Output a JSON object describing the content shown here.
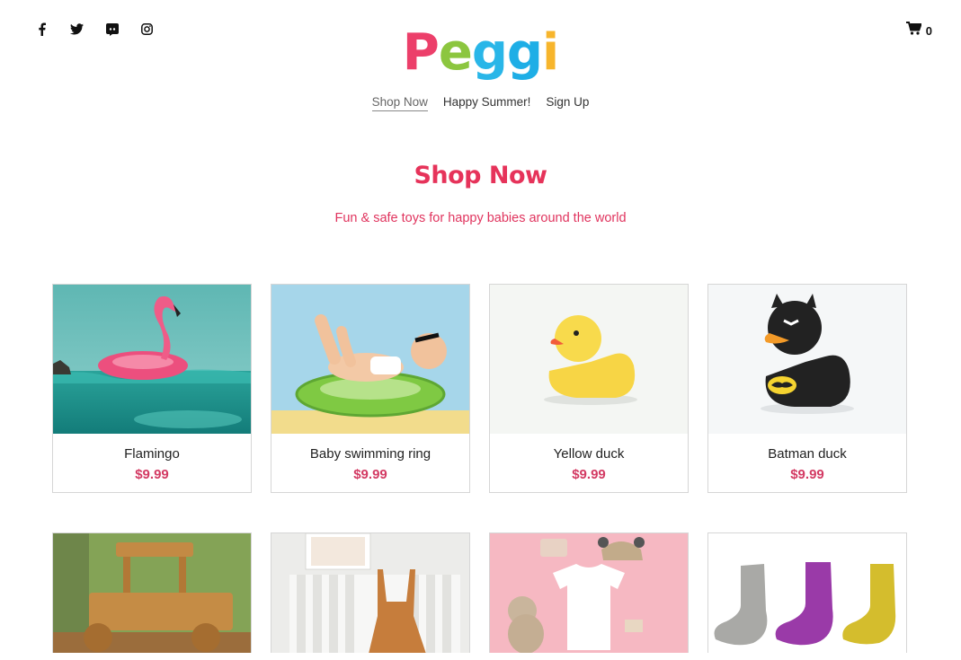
{
  "brand": {
    "letters": [
      {
        "char": "P",
        "color": "#ec3f6a"
      },
      {
        "char": "e",
        "color": "#8cc63f"
      },
      {
        "char": "g",
        "color": "#29b6e8"
      },
      {
        "char": "g",
        "color": "#1eaee6"
      },
      {
        "char": "i",
        "color": "#f7b52c"
      }
    ]
  },
  "social": [
    {
      "name": "facebook-icon"
    },
    {
      "name": "twitter-icon"
    },
    {
      "name": "discord-icon"
    },
    {
      "name": "instagram-icon"
    }
  ],
  "cart": {
    "icon": "cart-icon",
    "count": "0"
  },
  "nav": [
    {
      "label": "Shop Now",
      "active": true
    },
    {
      "label": "Happy Summer!",
      "active": false
    },
    {
      "label": "Sign Up",
      "active": false
    }
  ],
  "hero": {
    "title": "Shop Now",
    "subtitle": "Fun & safe toys for happy babies around the world"
  },
  "products": [
    {
      "title": "Flamingo",
      "price": "$9.99"
    },
    {
      "title": "Baby swimming ring",
      "price": "$9.99"
    },
    {
      "title": "Yellow duck",
      "price": "$9.99"
    },
    {
      "title": "Batman duck",
      "price": "$9.99"
    },
    {
      "title": "",
      "price": ""
    },
    {
      "title": "",
      "price": ""
    },
    {
      "title": "",
      "price": ""
    },
    {
      "title": "",
      "price": ""
    }
  ],
  "colors": {
    "accent": "#e6335a",
    "price": "#d33a63"
  }
}
